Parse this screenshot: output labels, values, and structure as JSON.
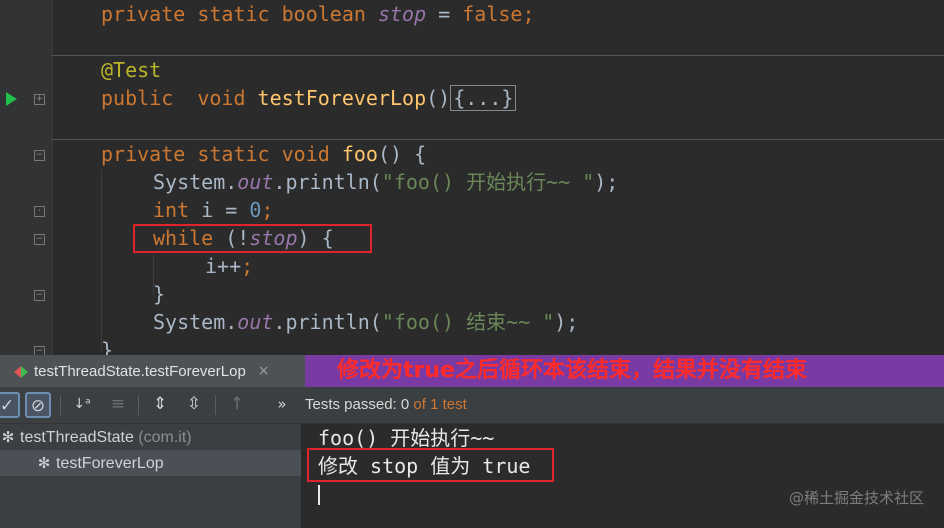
{
  "editor": {
    "line_field": {
      "kw": "private static boolean ",
      "field": "stop",
      "eq": " = ",
      "val": "false",
      "semi": ";"
    },
    "annotation": "@Test",
    "line_test": {
      "kw": "public  void ",
      "fn": "testForeverLop",
      "paren": "()",
      "folded": "{...}"
    },
    "line_foo": {
      "kw": "private static void ",
      "fn": "foo",
      "rest": "() {"
    },
    "line_print1": {
      "a": "System.",
      "out": "out",
      "b": ".println(",
      "str": "\"foo() 开始执行~~ \"",
      "c": ");"
    },
    "line_int": {
      "kw": "int ",
      "var": "i",
      "eq": " = ",
      "num": "0",
      "semi": ";"
    },
    "line_while": {
      "kw": "while",
      "a": " (!",
      "field": "stop",
      "b": ") {"
    },
    "line_inc": {
      "var": "i",
      "op": "++",
      "semi": ";"
    },
    "line_close1": "}",
    "line_print2": {
      "a": "System.",
      "out": "out",
      "b": ".println(",
      "str": "\"foo() 结束~~ \"",
      "c": ");"
    },
    "line_close2": "}"
  },
  "run_tab": {
    "label": "testThreadState.testForeverLop",
    "close": "×"
  },
  "banner": "修改为true之后循环本该结束，结果并没有结束",
  "toolbar": {
    "status_passed": "Tests passed: ",
    "status_count": "0",
    "status_of": " of 1 test",
    "chevrons": "»"
  },
  "tree": [
    {
      "label": "testThreadState",
      "detail": " (com.it)"
    },
    {
      "label": "testForeverLop",
      "detail": ""
    }
  ],
  "console": {
    "line1": "foo() 开始执行~~",
    "line2": "修改 stop 值为 true"
  },
  "watermark": "@稀土掘金技术社区",
  "colors": {
    "background": "#2b2b2b",
    "keyword": "#cc7832",
    "field": "#9876aa",
    "method": "#ffc66d",
    "string": "#6a8759",
    "number": "#6897bb",
    "banner_bg": "#7a3aa3",
    "highlight_box": "#e0242b"
  }
}
